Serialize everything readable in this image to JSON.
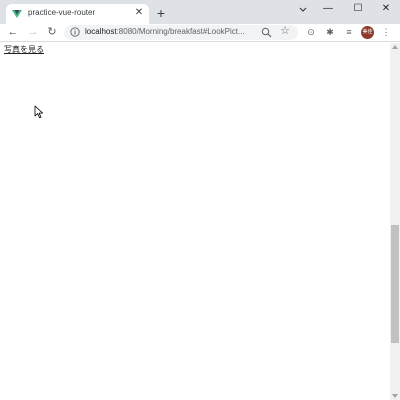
{
  "browser": {
    "tab": {
      "title": "practice-vue-router",
      "close": "✕",
      "favicon": "vue-icon"
    },
    "new_tab": "+",
    "window_controls": {
      "minimize": "—",
      "maximize": "☐",
      "close": "✕"
    },
    "toolbar": {
      "back": "←",
      "forward": "→",
      "reload": "↻",
      "url_host": "localhost",
      "url_path": ":8080/Morning/breakfast#LookPict...",
      "star": "☆",
      "ext1": "⊙",
      "ext2": "✱",
      "media": "≡",
      "avatar": "美佳",
      "menu": "⋮"
    }
  },
  "page": {
    "link_text": "写真を見る"
  },
  "colors": {
    "tab_strip": "#dee1e6",
    "avatar": "#8d3a2a"
  }
}
